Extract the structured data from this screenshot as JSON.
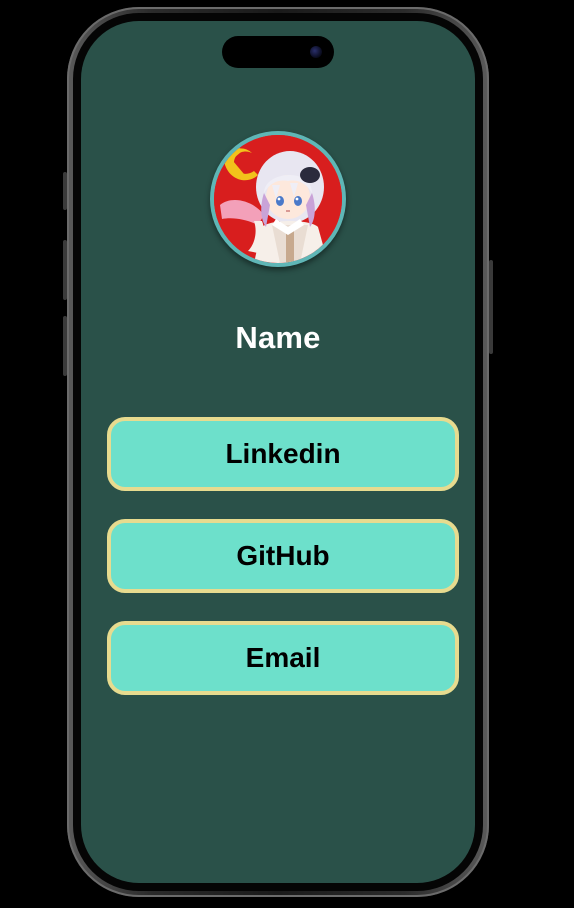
{
  "profile": {
    "name": "Name",
    "avatar_icon": "anime-avatar-icon"
  },
  "links": [
    {
      "label": "Linkedin",
      "icon": "none"
    },
    {
      "label": "GitHub",
      "icon": "none"
    },
    {
      "label": "Email",
      "icon": "none"
    }
  ],
  "colors": {
    "screen_background": "#2a5149",
    "button_fill": "#6de0cb",
    "button_border": "#e7db8f",
    "name_text": "#ffffff",
    "button_text": "#000000",
    "avatar_ring": "#5fb6b6"
  }
}
